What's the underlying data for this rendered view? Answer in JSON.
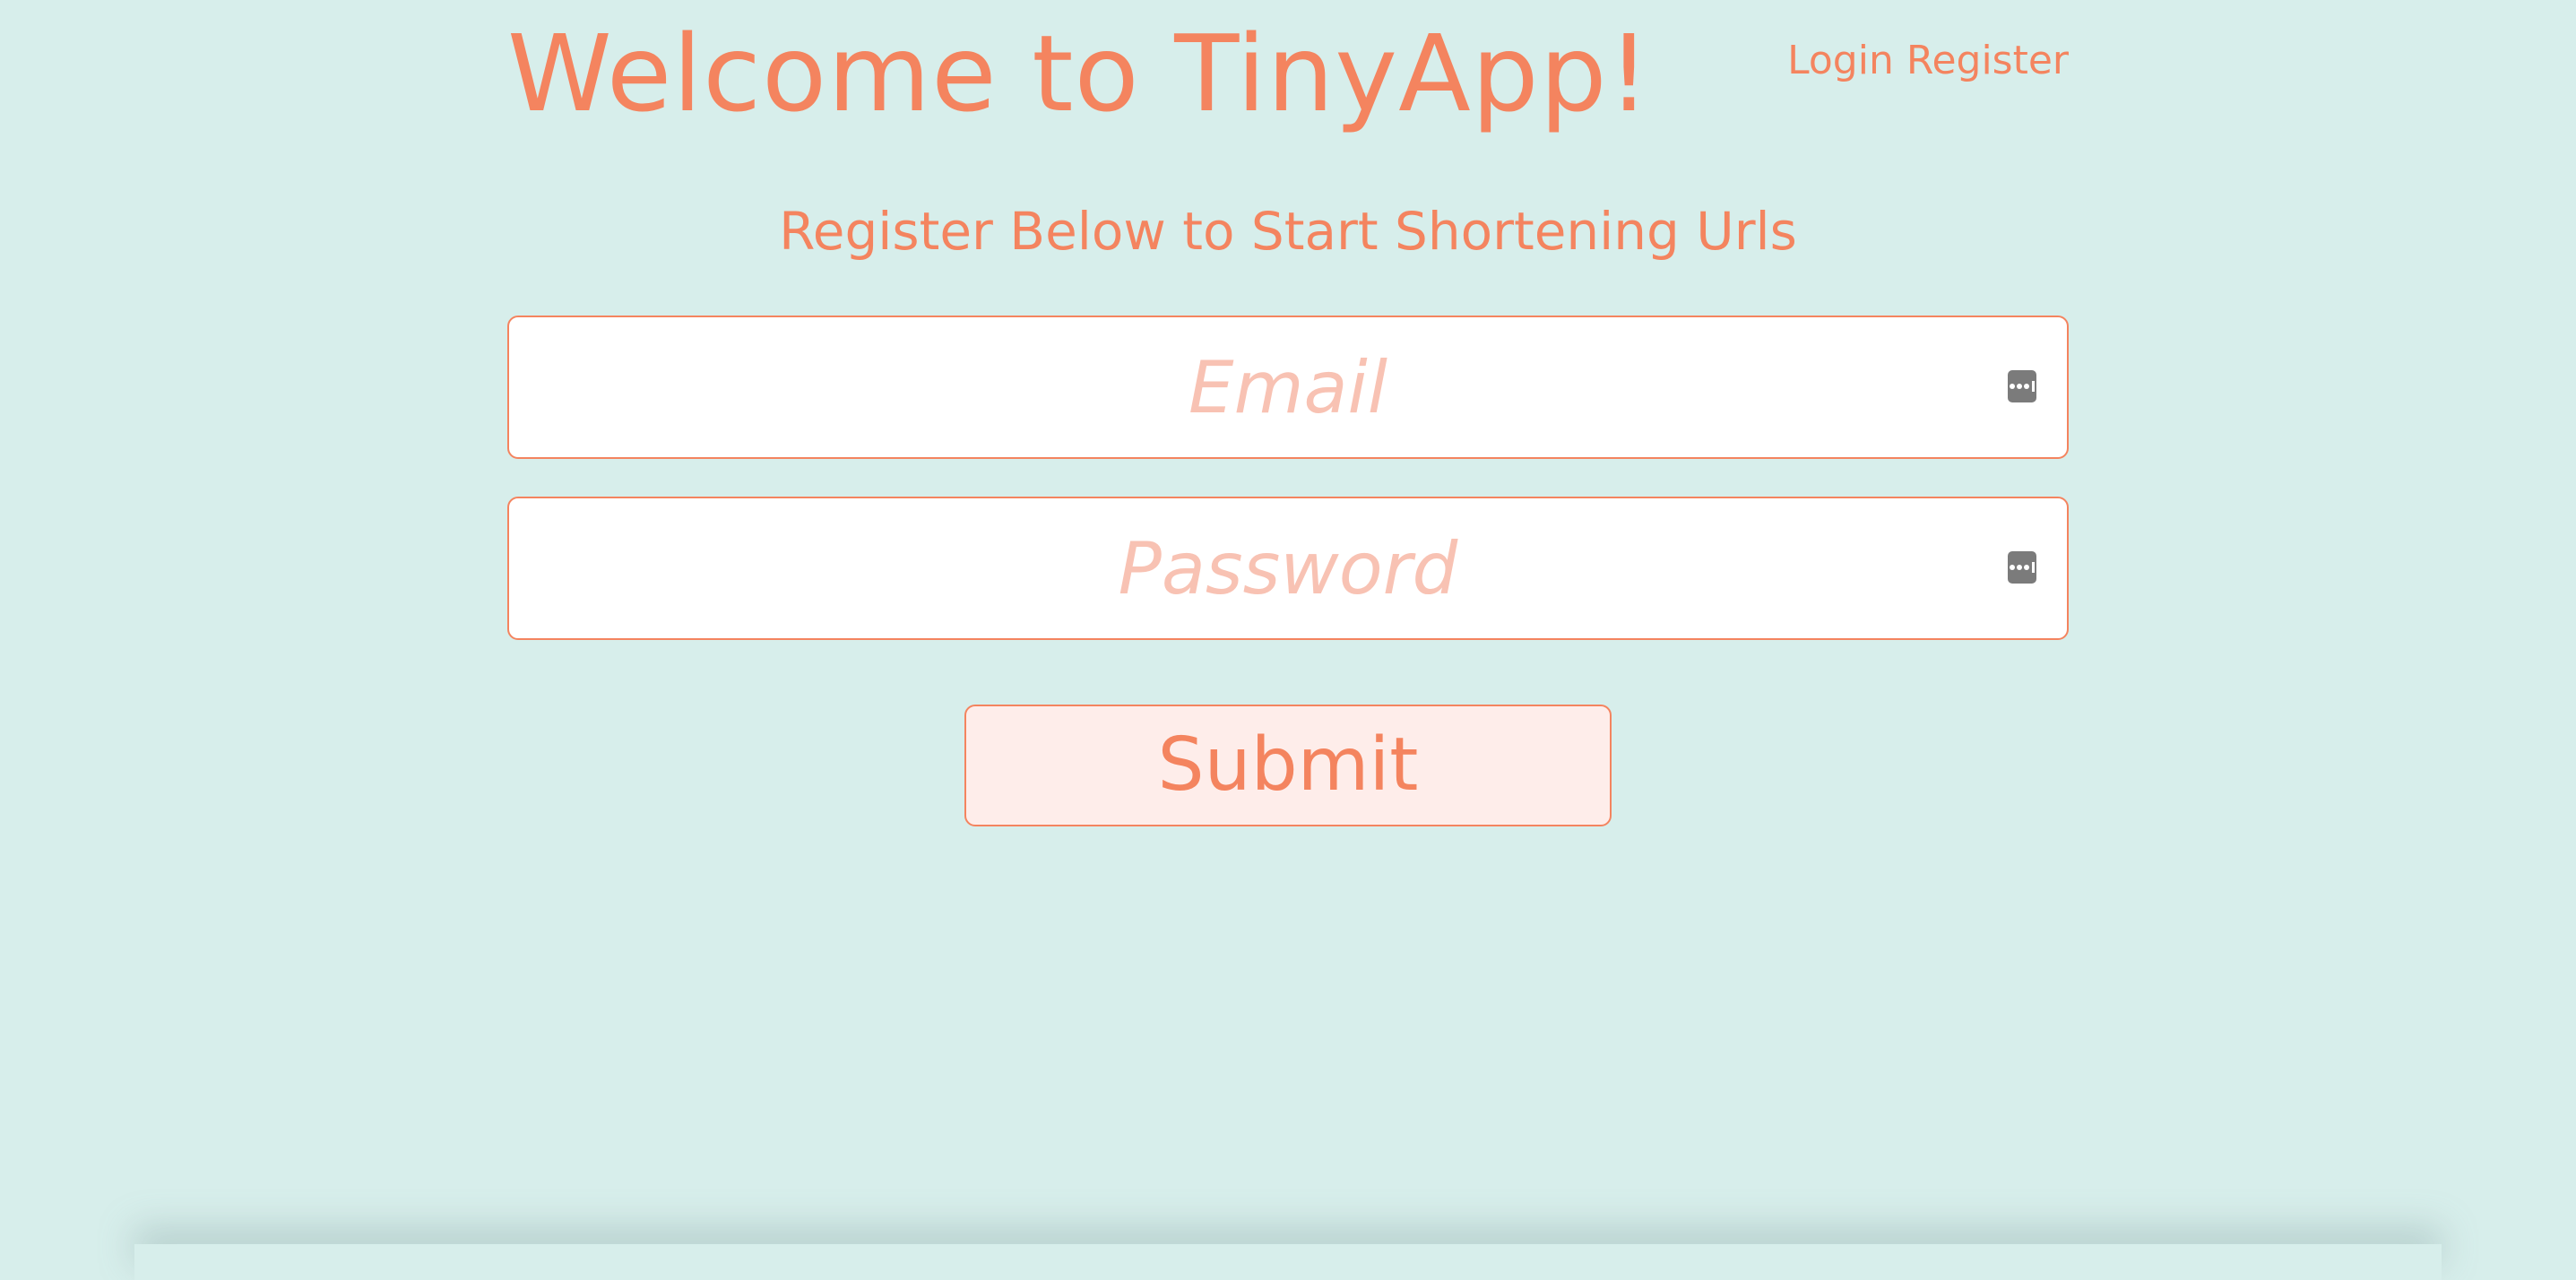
{
  "header": {
    "title": "Welcome to TinyApp!",
    "nav": {
      "login_label": "Login",
      "register_label": "Register"
    }
  },
  "main": {
    "subtitle": "Register Below to Start Shortening Urls",
    "form": {
      "email": {
        "placeholder": "Email",
        "value": ""
      },
      "password": {
        "placeholder": "Password",
        "value": ""
      },
      "submit_label": "Submit"
    }
  },
  "colors": {
    "background": "#d7eeeb",
    "accent": "#f4845f",
    "placeholder": "#f8c2b3",
    "button_background": "#feedea"
  },
  "icons": {
    "field_autofill": "password-manager-key-icon"
  }
}
